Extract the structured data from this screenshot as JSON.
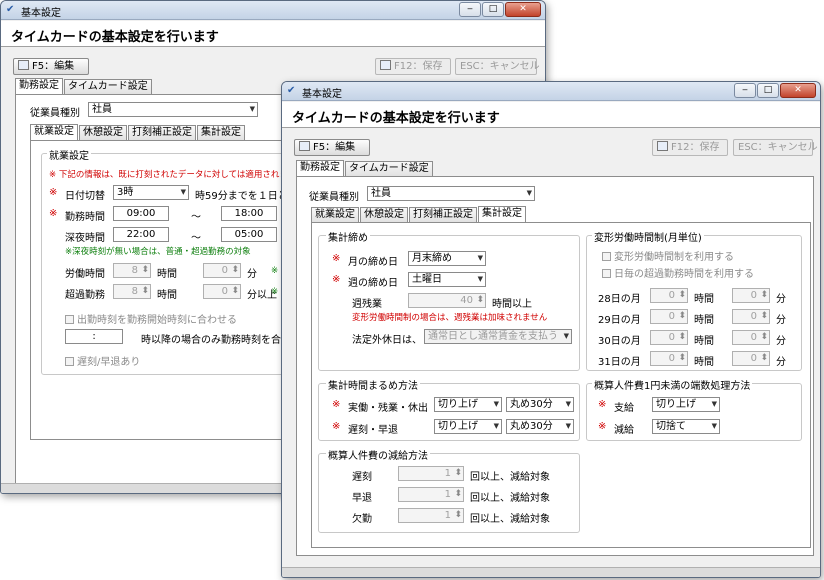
{
  "window_title": "基本設定",
  "header_title": "タイムカードの基本設定を行います",
  "toolbar": {
    "edit": "F5：編集",
    "save": "F12：保存",
    "cancel": "ESC：キャンセル"
  },
  "main_tabs": [
    "勤務設定",
    "タイムカード設定"
  ],
  "employee_type_label": "従業員種別",
  "employee_type_value": "社員",
  "sub_tabs": [
    "就業設定",
    "休憩設定",
    "打刻補正設定",
    "集計設定"
  ],
  "back": {
    "group_title": "就業設定",
    "note_top": "※ 下記の情報は、既に打刻されたデータに対しては適用されませ",
    "day_switch_label": "日付切替",
    "day_switch_value": "3時",
    "day_switch_note": "時59分までを１日とし",
    "work_time_label": "勤務時間",
    "work_start": "09:00",
    "work_end": "18:00",
    "night_time_label": "深夜時間",
    "night_start": "22:00",
    "night_end": "05:00",
    "tilde": "～",
    "night_note": "※深夜時刻が無い場合は、普通・超過勤務の対象",
    "labor_time_label": "労働時間",
    "labor_hours": "8",
    "labor_mins": "0",
    "overtime_label": "超過勤務",
    "overtime_hours": "8",
    "overtime_mins": "0",
    "unit_hour": "時間",
    "unit_min": "分",
    "unit_min_over": "分以上",
    "green_mark": "※",
    "align_check": "出勤時刻を勤務開始時刻に合わせる",
    "time_box": ":",
    "align_note": "時以降の場合のみ勤務時刻を合",
    "late_check": "遅刻/早退あり"
  },
  "front": {
    "closing": {
      "title": "集計締め",
      "month_label": "月の締め日",
      "month_value": "月末締め",
      "week_label": "週の締め日",
      "week_value": "土曜日",
      "weekly_ot_label": "週残業",
      "weekly_ot_value": "40",
      "weekly_ot_unit": "時間以上",
      "note": "変形労働時間制の場合は、週残業は加味されません",
      "holiday_label": "法定外休日は、",
      "holiday_value": "通常日とし通常賃金を支払う"
    },
    "variable": {
      "title": "変形労働時間制(月単位)",
      "check1": "変形労働時間制を利用する",
      "check2": "日毎の超過勤務時間を利用する",
      "rows": [
        {
          "label": "28日の月",
          "hours": "0",
          "mins": "0"
        },
        {
          "label": "29日の月",
          "hours": "0",
          "mins": "0"
        },
        {
          "label": "30日の月",
          "hours": "0",
          "mins": "0"
        },
        {
          "label": "31日の月",
          "hours": "0",
          "mins": "0"
        }
      ],
      "unit_hour": "時間",
      "unit_min": "分"
    },
    "rounding": {
      "title": "集計時間まるめ方法",
      "row1_label": "実働・残業・休出",
      "row1_sel1": "切り上げ",
      "row1_sel2": "丸め30分",
      "row2_label": "遅刻・早退",
      "row2_sel1": "切り上げ",
      "row2_sel2": "丸め30分"
    },
    "fraction": {
      "title": "概算人件費1円未満の端数処理方法",
      "pay_label": "支給",
      "pay_value": "切り上げ",
      "deduct_label": "減給",
      "deduct_value": "切捨て"
    },
    "reduction": {
      "title": "概算人件費の減給方法",
      "rows": [
        {
          "label": "遅刻",
          "value": "1"
        },
        {
          "label": "早退",
          "value": "1"
        },
        {
          "label": "欠勤",
          "value": "1"
        }
      ],
      "unit": "回以上、減給対象"
    },
    "req_mark": "※"
  }
}
